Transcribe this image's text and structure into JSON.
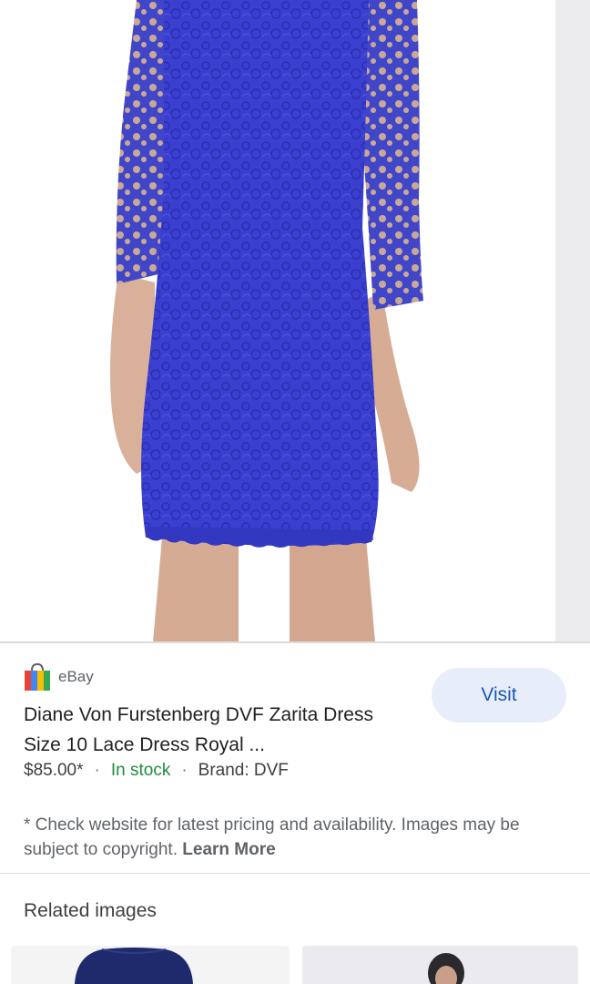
{
  "listing": {
    "source": "eBay",
    "visit_label": "Visit",
    "title": "Diane Von Furstenberg DVF Zarita Dress Size 10 Lace Dress Royal ...",
    "price": "$85.00*",
    "separator": "·",
    "stock": "In stock",
    "brand": "Brand: DVF"
  },
  "disclaimer": {
    "text": "* Check website for latest pricing and availability. Images may be subject to copyright.",
    "learn_more": "Learn More"
  },
  "related": {
    "heading": "Related images"
  },
  "colors": {
    "dress": "#3a3fd0",
    "in_stock": "#1e8e3e",
    "visit_text": "#1a56b5",
    "visit_bg": "#e8eef9"
  }
}
